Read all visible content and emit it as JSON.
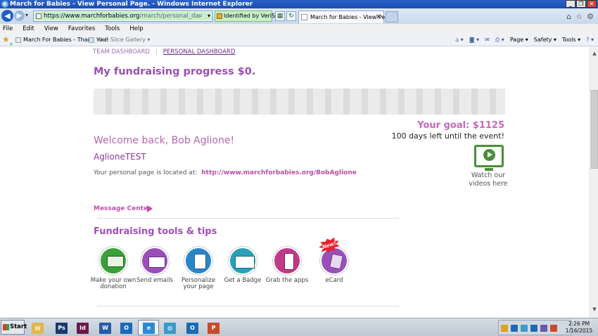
{
  "window": {
    "title": "March for Babies - View Personal Page. - Windows Internet Explorer",
    "controls": [
      "_",
      "❐",
      "✕"
    ]
  },
  "address_bar": {
    "url_host": "https://www.marchforbabies.org",
    "url_path": "/march/personal_dashboard.asp?intnav",
    "security_label": "Identified by VeriSign",
    "active_tab_title": "March for Babies - View Pers..."
  },
  "menu_bar": [
    "File",
    "Edit",
    "View",
    "Favorites",
    "Tools",
    "Help"
  ],
  "favorites_bar": {
    "items": [
      "March For Babies - Thank You!",
      "Web Slice Gallery ▾"
    ],
    "command_bar": [
      "Page ▾",
      "Safety ▾",
      "Tools ▾"
    ]
  },
  "page": {
    "breadcrumbs": {
      "team": "TEAM DASHBOARD",
      "personal": "PERSONAL DASHBOARD"
    },
    "progress_title": "My fundraising progress $0.",
    "progress": {
      "raised": 0,
      "goal": 1125
    },
    "goal_text": "Your goal: $1125",
    "days_left": "100 days left until the event!",
    "video_label": "Watch our videos here",
    "welcome": "Welcome back, Bob Aglione!",
    "username": "AglioneTEST",
    "page_location_label": "Your personal page is located at:",
    "page_location_url": "http://www.marchforbabies.org/BobAglione",
    "message_center": "Message Center",
    "tools_title": "Fundraising tools & tips",
    "tools": [
      {
        "label": "Make your own donation",
        "icon": "money-icon",
        "color": "#3aa03a"
      },
      {
        "label": "Send emails",
        "icon": "mail-icon",
        "color": "#9a4fb8"
      },
      {
        "label": "Personalize your page",
        "icon": "page-icon",
        "color": "#2a86c8"
      },
      {
        "label": "Get a Badge",
        "icon": "badge-icon",
        "color": "#2aa0b8"
      },
      {
        "label": "Grab the apps",
        "icon": "phone-icon",
        "color": "#c03a8a"
      },
      {
        "label": "eCard",
        "icon": "ecard-icon",
        "color": "#9a4fb8",
        "badge": "New!"
      }
    ],
    "colors": {
      "brand_purple": "#9a4fb2",
      "accent_pink": "#c768b8",
      "video_green": "#4a8f3a"
    }
  },
  "taskbar": {
    "start_label": "Start",
    "apps": [
      {
        "name": "file-explorer",
        "glyph": "▤",
        "color": "#e2b84a"
      },
      {
        "name": "photoshop",
        "glyph": "Ps",
        "color": "#1a3a6a"
      },
      {
        "name": "indesign",
        "glyph": "Id",
        "color": "#6a1a4a"
      },
      {
        "name": "word",
        "glyph": "W",
        "color": "#2a5aa8"
      },
      {
        "name": "outlook",
        "glyph": "O",
        "color": "#1a6ab8"
      },
      {
        "name": "internet-explorer",
        "glyph": "e",
        "color": "#2a8ad8"
      },
      {
        "name": "network-app",
        "glyph": "◍",
        "color": "#3a9ac8"
      },
      {
        "name": "outlook-2",
        "glyph": "O",
        "color": "#1a6ab8"
      },
      {
        "name": "powerpoint",
        "glyph": "P",
        "color": "#c84a2a"
      }
    ],
    "clock_time": "2:26 PM",
    "clock_date": "1/16/2015"
  }
}
